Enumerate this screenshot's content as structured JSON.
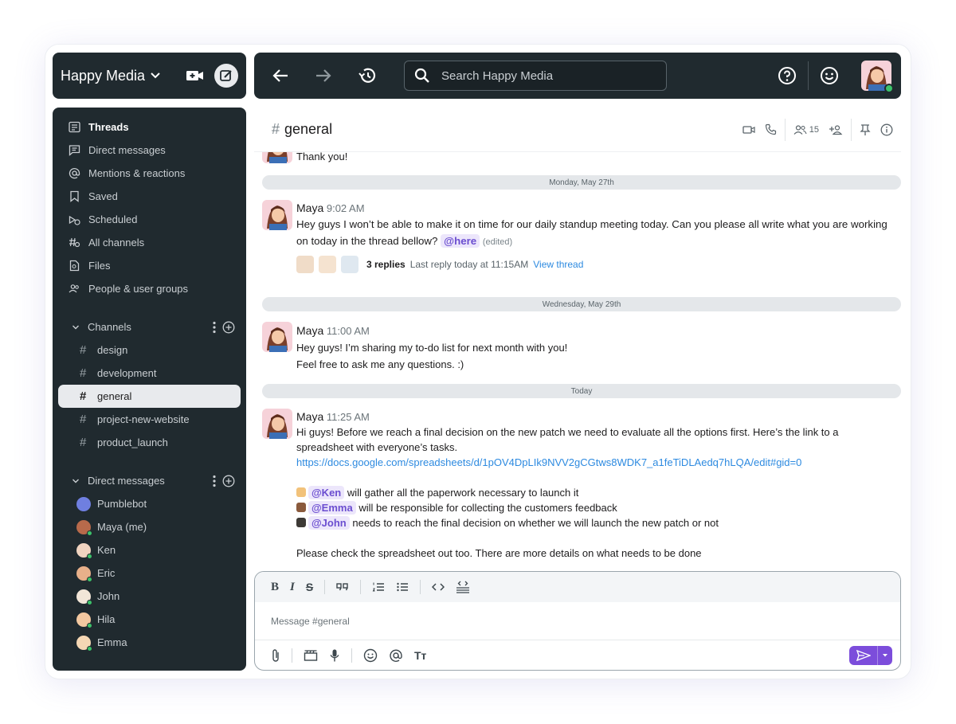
{
  "workspace": {
    "name": "Happy Media"
  },
  "search": {
    "placeholder": "Search Happy Media"
  },
  "sidebar": {
    "nav": [
      {
        "label": "Threads",
        "icon": "threads-icon"
      },
      {
        "label": "Direct messages",
        "icon": "direct-messages-icon"
      },
      {
        "label": "Mentions & reactions",
        "icon": "at-icon"
      },
      {
        "label": "Saved",
        "icon": "bookmark-icon"
      },
      {
        "label": "Scheduled",
        "icon": "scheduled-icon"
      },
      {
        "label": "All channels",
        "icon": "all-channels-icon"
      },
      {
        "label": "Files",
        "icon": "files-icon"
      },
      {
        "label": "People & user groups",
        "icon": "people-icon"
      }
    ],
    "channels_label": "Channels",
    "channels": [
      "design",
      "development",
      "general",
      "project-new-website",
      "product_launch"
    ],
    "active_channel": "general",
    "dms_label": "Direct messages",
    "dms": [
      "Pumblebot",
      "Maya (me)",
      "Ken",
      "Eric",
      "John",
      "Hila",
      "Emma"
    ]
  },
  "channel": {
    "name": "general",
    "member_count": "15"
  },
  "messages": {
    "prev_text": "Thank you!",
    "date1": "Monday, May 27th",
    "m1": {
      "author": "Maya",
      "time": "9:02 AM",
      "text": "Hey guys I won’t be able to make it on time for our daily standup meeting today. Can you please all write what you are working on today in the thread bellow?",
      "mention": "@here",
      "edited": "(edited)",
      "replies": "3 replies",
      "last_reply": "Last reply today at 11:15AM",
      "view_thread": "View thread"
    },
    "date2": "Wednesday, May 29th",
    "m2": {
      "author": "Maya",
      "time": "11:00 AM",
      "line1": "Hey guys! I’m sharing my to-do list for next month with you!",
      "line2": "Feel free to ask me any questions. :)"
    },
    "date3": "Today",
    "m3": {
      "author": "Maya",
      "time": "11:25 AM",
      "text": "Hi guys! Before we reach a final decision on the new patch we need to evaluate all the options first. Here’s the link to a spreadsheet with everyone’s tasks.",
      "link": "https://docs.google.com/spreadsheets/d/1pOV4DpLIk9NVV2gCGtws8WDK7_a1feTiDLAedq7hLQA/edit#gid=0",
      "tasks": [
        {
          "mention": "@Ken",
          "text": "will gather all the paperwork necessary to launch it"
        },
        {
          "mention": "@Emma",
          "text": "will be responsible for collecting the customers feedback"
        },
        {
          "mention": "@John",
          "text": "needs to reach the final decision on whether we will launch the new patch or not"
        }
      ],
      "footer": "Please check the spreadsheet out too. There are more details on what needs to be done"
    }
  },
  "composer": {
    "placeholder": "Message #general"
  },
  "colors": {
    "accent": "#7c4ddb",
    "sidebar_bg": "#202a2f",
    "online": "#3cc26a",
    "link": "#2d8ae0"
  }
}
